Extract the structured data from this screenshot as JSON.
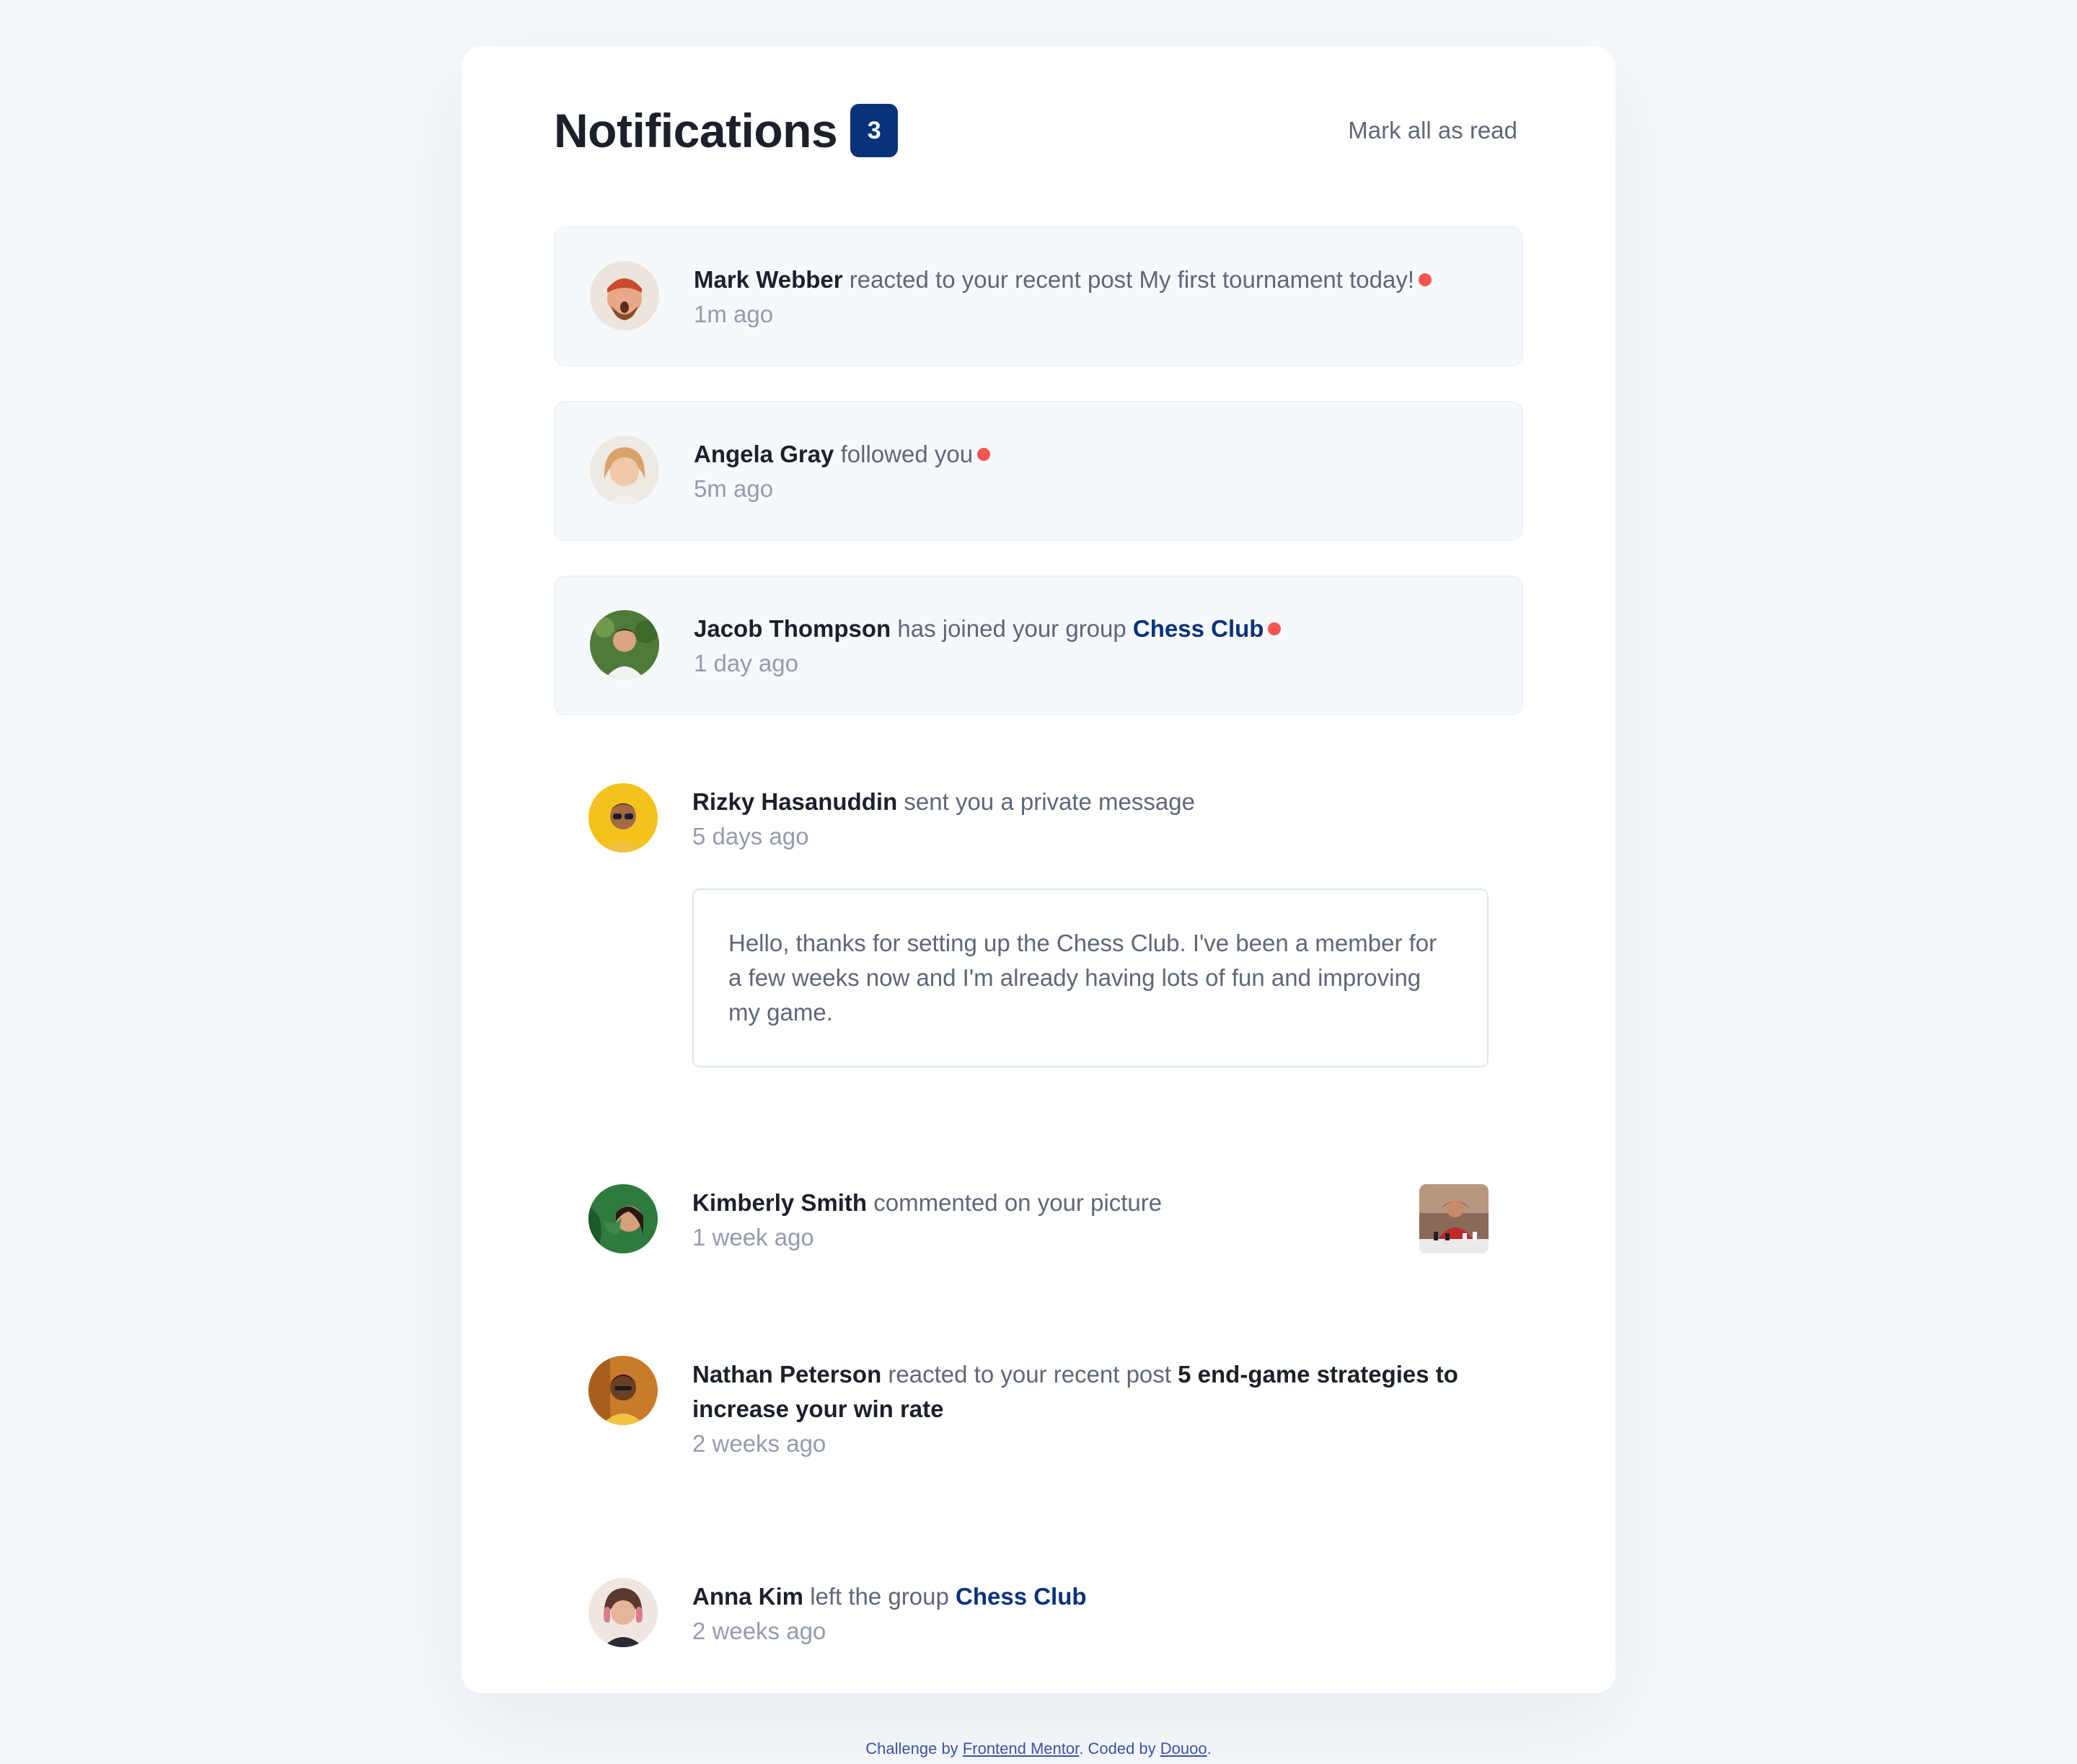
{
  "header": {
    "title": "Notifications",
    "unread_count": "3",
    "mark_all_label": "Mark all as read"
  },
  "notifications": [
    {
      "name": "Mark Webber",
      "action": "reacted to your recent post",
      "post": "My first tournament today!",
      "time": "1m ago",
      "unread": true
    },
    {
      "name": "Angela Gray",
      "action": "followed you",
      "time": "5m ago",
      "unread": true
    },
    {
      "name": "Jacob Thompson",
      "action": "has joined your group",
      "group": "Chess Club",
      "time": "1 day ago",
      "unread": true
    },
    {
      "name": "Rizky Hasanuddin",
      "action": "sent you a private message",
      "time": "5 days ago",
      "unread": false,
      "message": "Hello, thanks for setting up the Chess Club. I've been a member for a few weeks now and I'm already having lots of fun and improving my game."
    },
    {
      "name": "Kimberly Smith",
      "action": "commented on your picture",
      "time": "1 week ago",
      "unread": false
    },
    {
      "name": "Nathan Peterson",
      "action": "reacted to your recent post",
      "post": "5 end-game strategies to increase your win rate",
      "time": "2 weeks ago",
      "unread": false
    },
    {
      "name": "Anna Kim",
      "action": "left the group",
      "group": "Chess Club",
      "time": "2 weeks ago",
      "unread": false
    }
  ],
  "footer": {
    "prefix": "Challenge by",
    "link1": "Frontend Mentor",
    "middle": ". Coded by",
    "link2": "Douoo",
    "suffix": "."
  },
  "colors": {
    "accent": "#0a327b",
    "dot": "#f65552",
    "unread_bg": "#f6f9fc",
    "text_dark": "#1c202b"
  }
}
